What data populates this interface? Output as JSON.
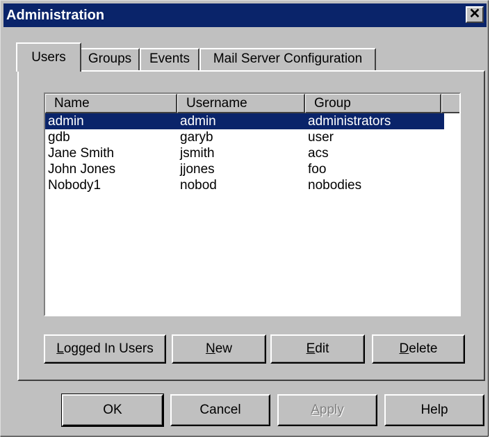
{
  "window": {
    "title": "Administration",
    "close_glyph": "✕"
  },
  "tabs": [
    {
      "label": "Users",
      "active": true
    },
    {
      "label": "Groups",
      "active": false
    },
    {
      "label": "Events",
      "active": false
    },
    {
      "label": "Mail Server Configuration",
      "active": false
    }
  ],
  "users_table": {
    "columns": [
      "Name",
      "Username",
      "Group"
    ],
    "rows": [
      {
        "name": "admin",
        "username": "admin",
        "group": "administrators",
        "selected": true
      },
      {
        "name": "gdb",
        "username": "garyb",
        "group": "user",
        "selected": false
      },
      {
        "name": "Jane Smith",
        "username": "jsmith",
        "group": "acs",
        "selected": false
      },
      {
        "name": "John Jones",
        "username": "jjones",
        "group": "foo",
        "selected": false
      },
      {
        "name": "Nobody1",
        "username": "nobod",
        "group": "nobodies",
        "selected": false
      }
    ]
  },
  "panel_buttons": {
    "logged_in_users": {
      "mnemonic": "L",
      "rest": "ogged In Users"
    },
    "new": {
      "mnemonic": "N",
      "rest": "ew"
    },
    "edit": {
      "mnemonic": "E",
      "rest": "dit"
    },
    "delete": {
      "mnemonic": "D",
      "rest": "elete"
    }
  },
  "dialog_buttons": {
    "ok": "OK",
    "cancel": "Cancel",
    "apply": {
      "mnemonic": "A",
      "rest": "pply",
      "disabled": true
    },
    "help": "Help"
  },
  "colors": {
    "face": "#c0c0c0",
    "titlebar": "#0a246a",
    "selection": "#0a246a"
  }
}
